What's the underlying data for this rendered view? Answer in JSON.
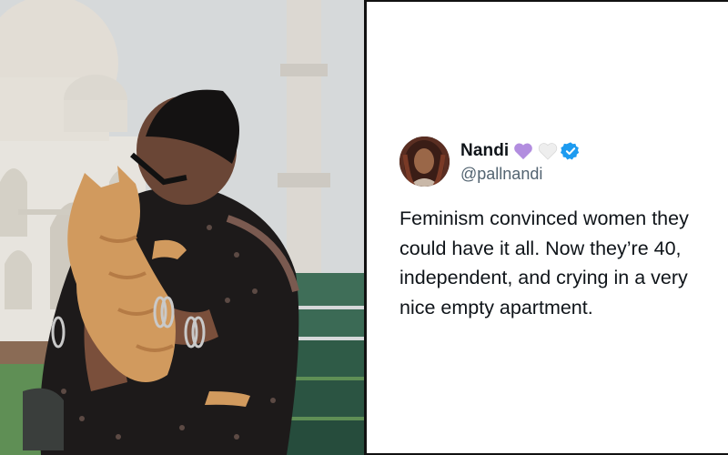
{
  "tweet": {
    "display_name": "Nandi",
    "emojis": [
      "purple-heart",
      "white-heart"
    ],
    "verified": true,
    "handle": "@pallnandi",
    "text_lines": [
      "Feminism convinced women they",
      "could have it all. Now they’re 40,",
      "independent, and crying in a very",
      "nice empty apartment."
    ]
  },
  "colors": {
    "name": "#0f1419",
    "handle": "#536471",
    "verified": "#1d9bf0",
    "purple_heart": "#b28ddf",
    "white_heart": "#eeeeee"
  }
}
